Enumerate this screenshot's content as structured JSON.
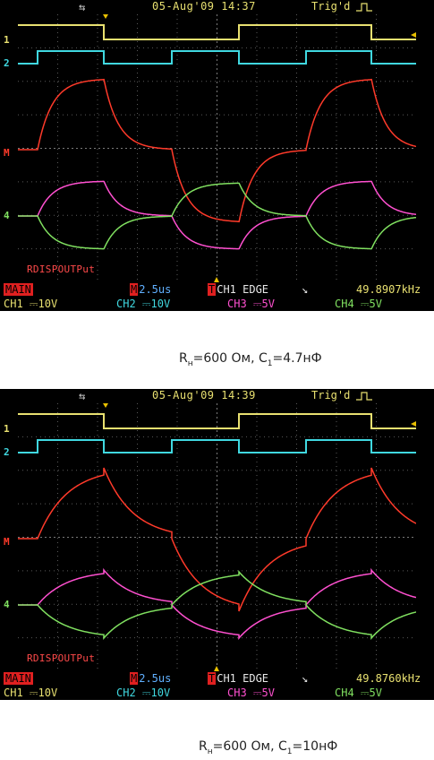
{
  "scopes": [
    {
      "date_time": "05-Aug'09 14:37",
      "trigger_status": "Trig'd",
      "overlay_label": "RDISPOUTPut",
      "timebase_mode": "MAIN",
      "timebase": "2.5us",
      "trigger_source": "CH1 EDGE",
      "frequency": "49.8907kHz",
      "channels": [
        {
          "label": "CH1",
          "scale": "10V"
        },
        {
          "label": "CH2",
          "scale": "10V"
        },
        {
          "label": "CH3",
          "scale": "5V"
        },
        {
          "label": "CH4",
          "scale": "5V"
        }
      ],
      "caption": {
        "r_sym": "R",
        "r_sub": "н",
        "r_val": "=600 Ом, ",
        "c_sym": "C",
        "c_sub": "1",
        "c_val": "=4.7нФ"
      }
    },
    {
      "date_time": "05-Aug'09 14:39",
      "trigger_status": "Trig'd",
      "overlay_label": "RDISPOUTPut",
      "timebase_mode": "MAIN",
      "timebase": "2.5us",
      "trigger_source": "CH1 EDGE",
      "frequency": "49.8760kHz",
      "channels": [
        {
          "label": "CH1",
          "scale": "10V"
        },
        {
          "label": "CH2",
          "scale": "10V"
        },
        {
          "label": "CH3",
          "scale": "5V"
        },
        {
          "label": "CH4",
          "scale": "5V"
        }
      ],
      "caption": {
        "r_sym": "R",
        "r_sub": "н",
        "r_val": "=600 Ом, ",
        "c_sym": "C",
        "c_sub": "1",
        "c_val": "=10нФ"
      }
    }
  ],
  "channel_markers": [
    "1",
    "2",
    "M",
    "4"
  ],
  "colors": {
    "ch1": "#e8e070",
    "ch2": "#40d8e0",
    "ch3": "#ff50d0",
    "ch4": "#80e060",
    "math": "#ff3a2a",
    "grid": "#5a5a5a"
  }
}
